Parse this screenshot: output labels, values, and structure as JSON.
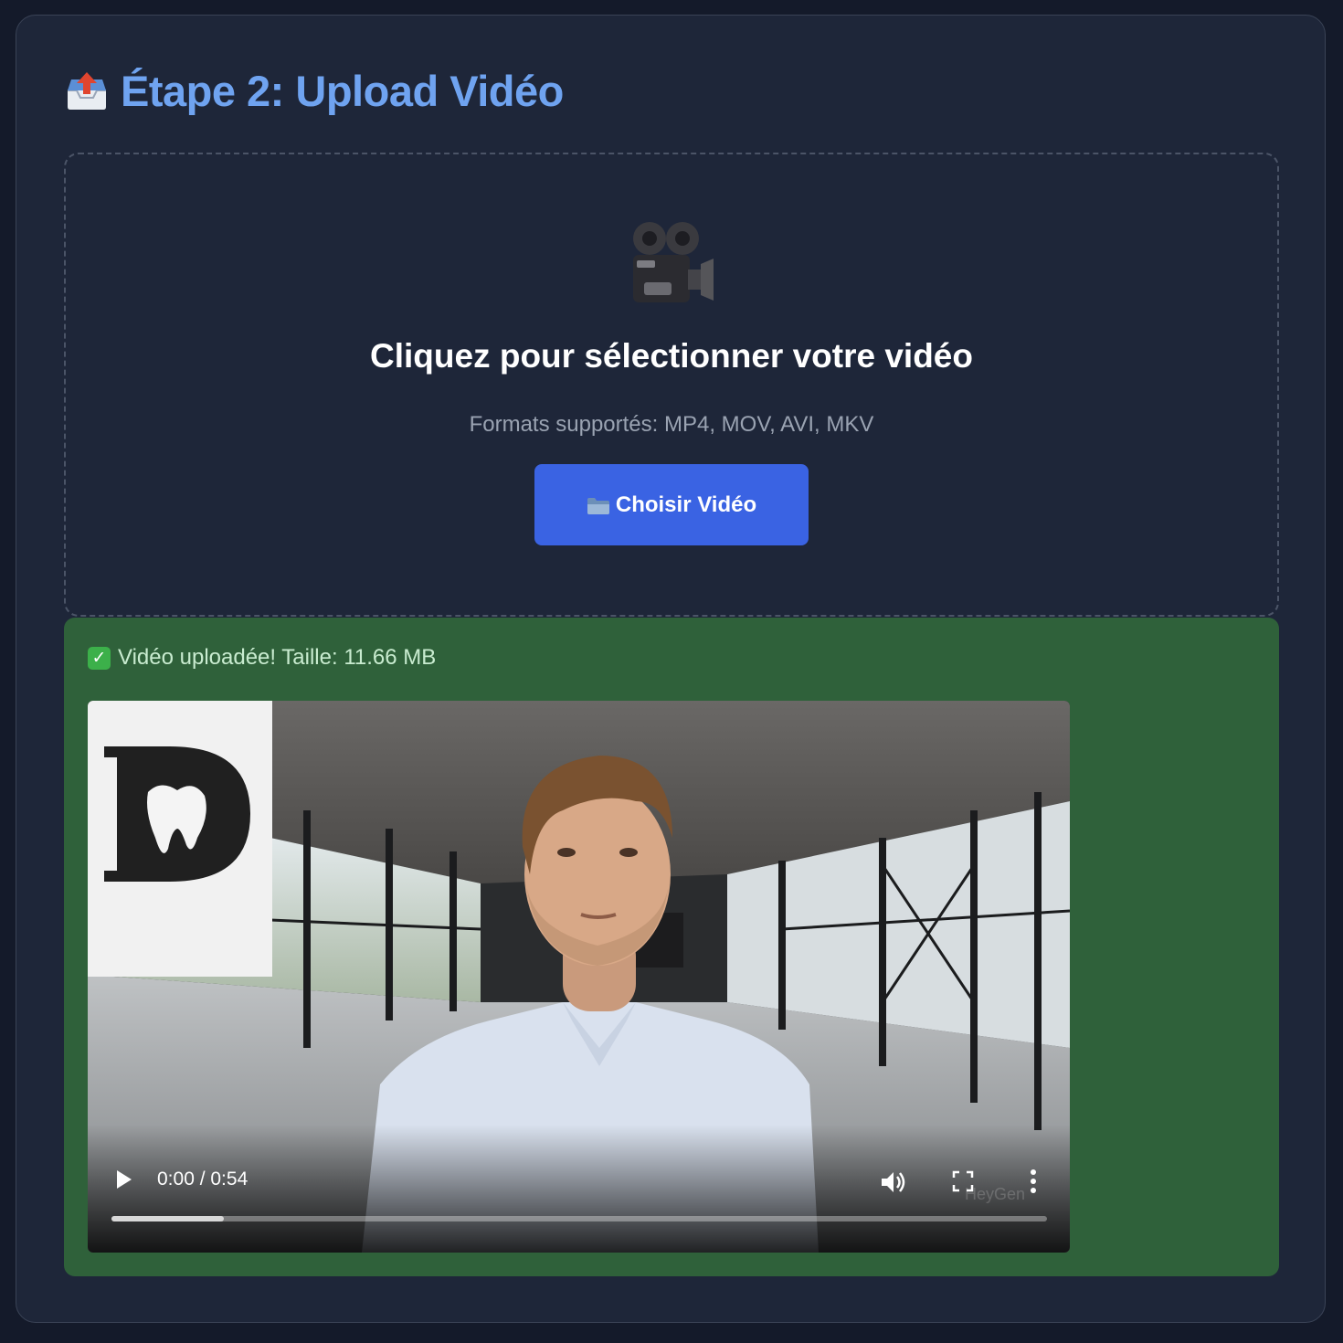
{
  "step": {
    "title": "Étape 2: Upload Vidéo",
    "title_icon": "outbox-tray-icon"
  },
  "dropzone": {
    "icon": "movie-camera-icon",
    "title": "Cliquez pour sélectionner votre vidéo",
    "formats": "Formats supportés: MP4, MOV, AVI, MKV",
    "button_icon": "folder-icon",
    "button_label": "Choisir Vidéo"
  },
  "upload_status": {
    "icon": "check-mark-icon",
    "text": "Vidéo uploadée! Taille: 11.66 MB"
  },
  "player": {
    "time": "0:00 / 0:54",
    "buffered_fraction": 0.12,
    "logo_letter": "D",
    "watermark": "HeyGen"
  },
  "colors": {
    "accent": "#6fa3f0",
    "button": "#3a63e3",
    "success_bg": "#2f613a",
    "card_bg": "#1e2639"
  }
}
